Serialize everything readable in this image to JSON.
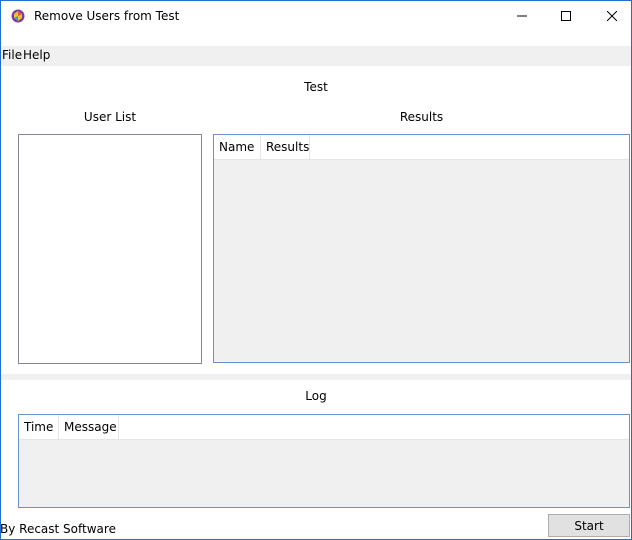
{
  "window": {
    "title": "Remove Users from Test",
    "controls": {
      "minimize": "minimize-icon",
      "maximize": "maximize-icon",
      "close": "close-icon"
    }
  },
  "menu": {
    "items": [
      "File",
      "Help"
    ]
  },
  "main": {
    "section_title": "Test",
    "user_list": {
      "label": "User List"
    },
    "results": {
      "label": "Results",
      "columns": [
        "Name",
        "Results"
      ]
    }
  },
  "log": {
    "label": "Log",
    "columns": [
      "Time",
      "Message"
    ]
  },
  "footer": {
    "credit": "By Recast Software",
    "start_label": "Start"
  },
  "colors": {
    "accent_border": "#6a93c8",
    "window_border": "#1e6fd0",
    "panel_bg": "#f0f0f0"
  }
}
